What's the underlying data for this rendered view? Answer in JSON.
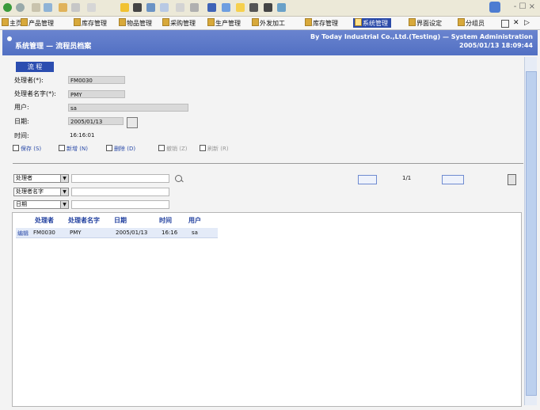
{
  "toolbar": {
    "icon_names": [
      "back-icon",
      "forward-icon",
      "home-icon",
      "refresh-icon",
      "favorites-icon",
      "history-icon",
      "mail-icon",
      "print-icon",
      "edit-icon",
      "calendar-icon",
      "tools-icon",
      "help-icon",
      "user-icon",
      "folder-icon",
      "lock-icon",
      "window-icon",
      "grid-icon"
    ],
    "window_controls": "- ☐ ×"
  },
  "menu": {
    "items": [
      {
        "label": "主页",
        "active": false
      },
      {
        "label": "产品管理",
        "active": false
      },
      {
        "label": "库存管理",
        "active": false
      },
      {
        "label": "物品管理",
        "active": false
      },
      {
        "label": "采购管理",
        "active": false
      },
      {
        "label": "生产管理",
        "active": false
      },
      {
        "label": "外发加工",
        "active": false
      },
      {
        "label": "库存管理",
        "active": false
      },
      {
        "label": "系统管理",
        "active": true
      },
      {
        "label": "界面设定",
        "active": false
      },
      {
        "label": "分组员",
        "active": false
      }
    ],
    "right_icons": [
      "grid-icon",
      "close-icon",
      "next-icon"
    ]
  },
  "title": {
    "breadcrumb": "系统管理 — 流程员档案",
    "company": "By Today Industrial Co.,Ltd.(Testing) — System Administration",
    "datetime": "2005/01/13 18:09:44"
  },
  "form": {
    "tab": "流 程",
    "fields": [
      {
        "label": "处理者(*):",
        "value": "FM0030"
      },
      {
        "label": "处理者名字(*):",
        "value": "PMY"
      },
      {
        "label": "用户:",
        "value": "sa"
      },
      {
        "label": "日期:",
        "value": "2005/01/13"
      },
      {
        "label": "时间:",
        "value": "16:16:01"
      }
    ],
    "actions": [
      {
        "label": "保存 (S)",
        "enabled": true
      },
      {
        "label": "新增 (N)",
        "enabled": true
      },
      {
        "label": "删除 (D)",
        "enabled": true
      },
      {
        "label": "撤销 (Z)",
        "enabled": false
      },
      {
        "label": "刷新 (R)",
        "enabled": false
      }
    ]
  },
  "search": {
    "selects": [
      {
        "value": "处理者",
        "arrow": "▼"
      },
      {
        "value": "处理者名字",
        "arrow": "▼"
      },
      {
        "value": "日期",
        "arrow": "▼"
      }
    ],
    "pager": "1/1"
  },
  "grid": {
    "columns": [
      "处理者",
      "处理者名字",
      "日期",
      "时间",
      "用户"
    ],
    "rows": [
      {
        "action": "编辑",
        "handler": "FM0030",
        "name": "PMY",
        "date": "2005/01/13",
        "time": "16:16",
        "user": "sa"
      }
    ]
  }
}
